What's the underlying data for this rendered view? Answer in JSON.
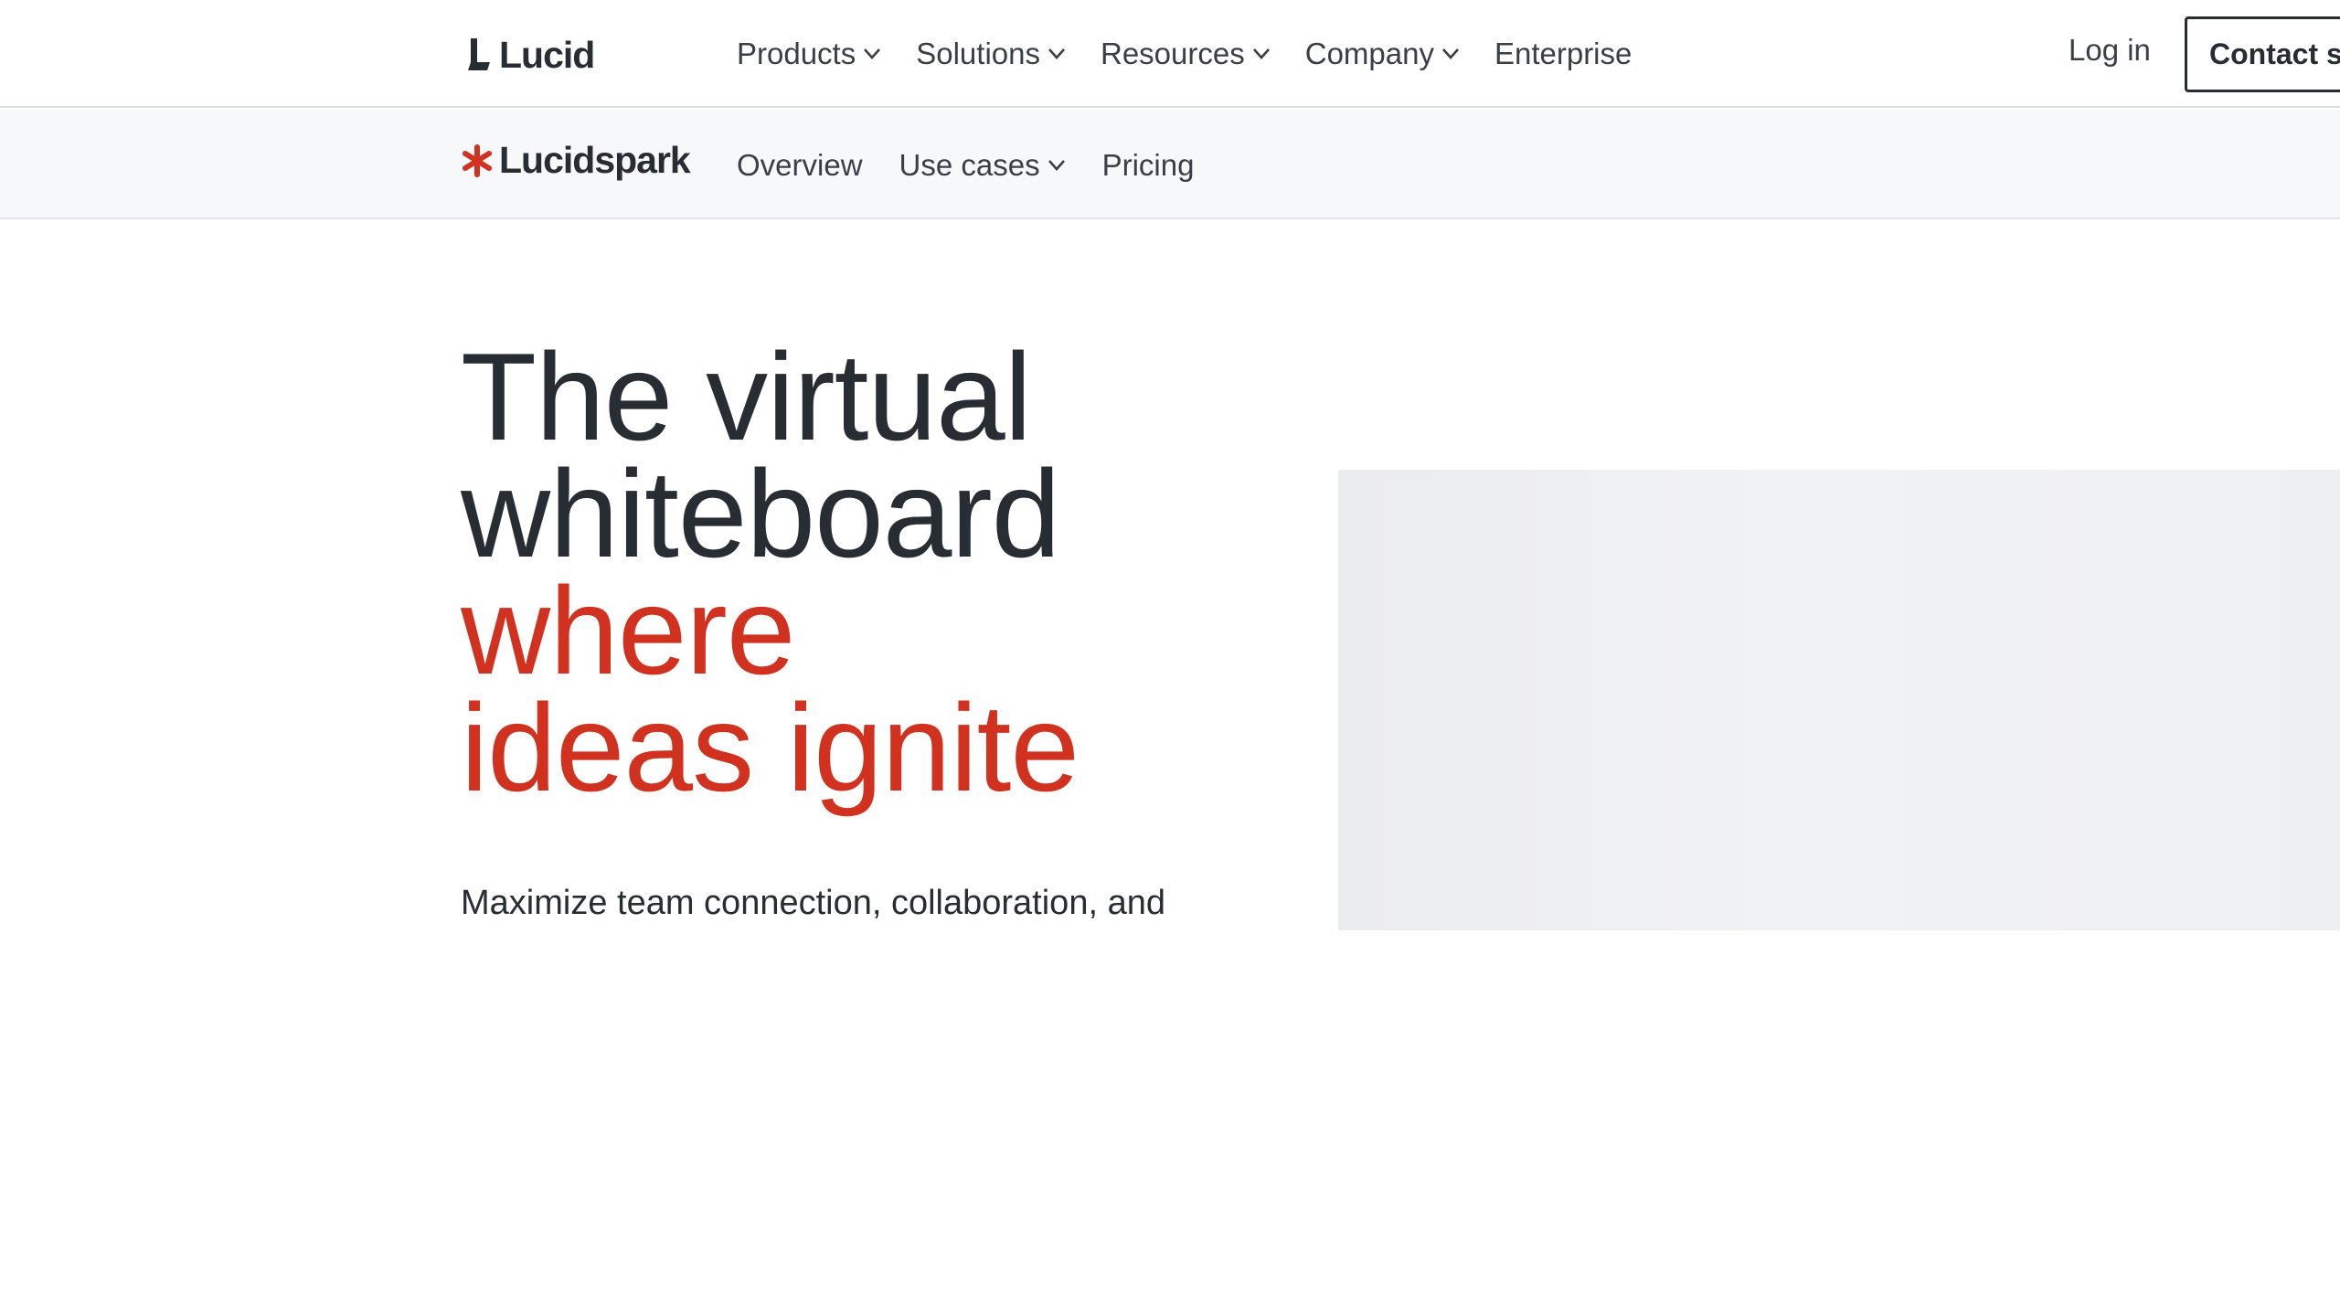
{
  "header": {
    "brand": "Lucid",
    "menu": [
      {
        "label": "Products",
        "has_dropdown": true
      },
      {
        "label": "Solutions",
        "has_dropdown": true
      },
      {
        "label": "Resources",
        "has_dropdown": true
      },
      {
        "label": "Company",
        "has_dropdown": true
      },
      {
        "label": "Enterprise",
        "has_dropdown": false
      }
    ],
    "login_label": "Log in",
    "contact_label": "Contact s"
  },
  "subnav": {
    "brand": "Lucidspark",
    "items": [
      {
        "label": "Overview",
        "has_dropdown": false
      },
      {
        "label": "Use cases",
        "has_dropdown": true
      },
      {
        "label": "Pricing",
        "has_dropdown": false
      }
    ]
  },
  "hero": {
    "title_line1": "The virtual",
    "title_line2": "whiteboard",
    "title_accent_line1": "where",
    "title_accent_line2": "ideas ignite",
    "subtitle": "Maximize team connection, collaboration, and"
  },
  "colors": {
    "accent": "#d1321f",
    "text": "#282c33",
    "subnav_bg": "#f7f8fa",
    "media_placeholder": "#ebecef"
  },
  "icons": {
    "lucid_logo": "lucid-logo-icon",
    "spark": "spark-asterisk-icon",
    "dropdown": "chevron-down-icon"
  }
}
